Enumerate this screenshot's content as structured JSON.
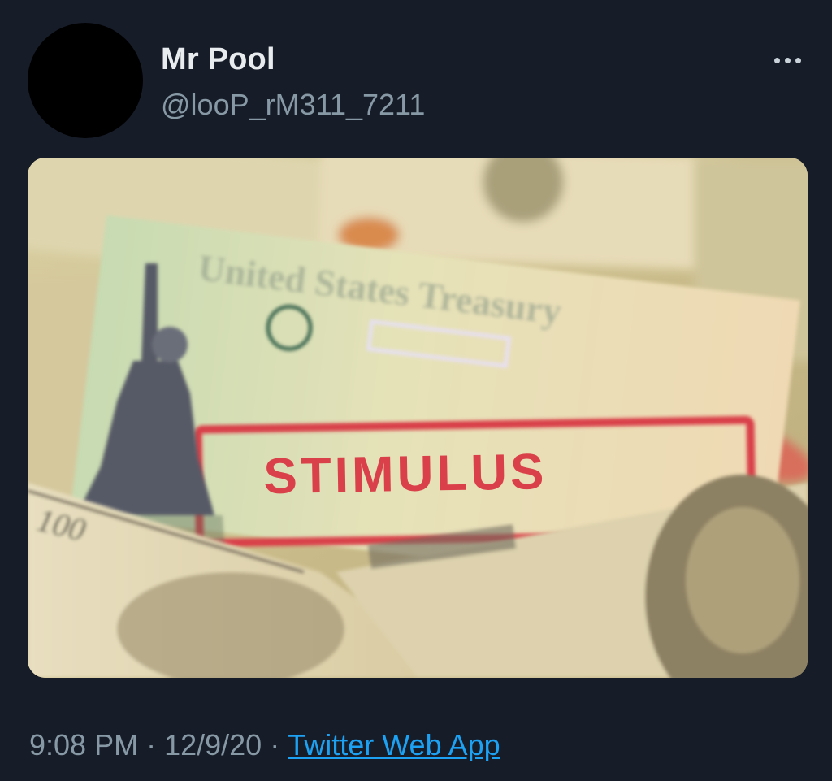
{
  "tweet": {
    "display_name": "Mr Pool",
    "handle": "@looP_rM311_7211",
    "more_icon": "more-horizontal-icon",
    "media": {
      "stamp_text": "STIMULUS",
      "bill_text": "100"
    },
    "footer": {
      "time": "9:08 PM",
      "separator": "·",
      "date": "12/9/20",
      "source": "Twitter Web App"
    }
  },
  "colors": {
    "background": "#161c28",
    "link": "#1da1f2",
    "secondary_text": "#8899a6",
    "stamp_red": "#d9404a"
  }
}
